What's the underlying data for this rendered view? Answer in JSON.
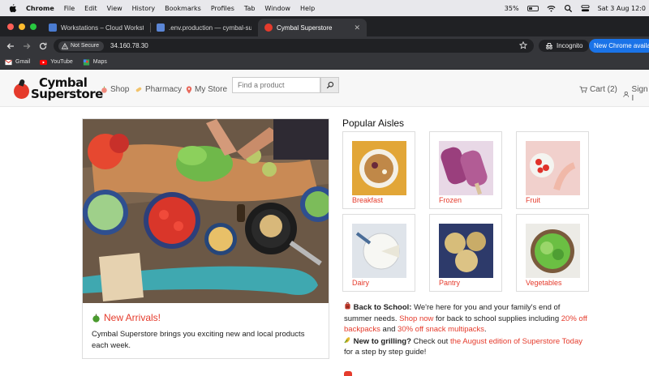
{
  "menubar": {
    "app": "Chrome",
    "items": [
      "File",
      "Edit",
      "View",
      "History",
      "Bookmarks",
      "Profiles",
      "Tab",
      "Window",
      "Help"
    ],
    "battery": "35%",
    "datetime": "Sat 3 Aug 12:0"
  },
  "tabs": [
    {
      "title": "Workstations – Cloud Workst",
      "active": false
    },
    {
      "title": ".env.production — cymbal-su",
      "active": false
    },
    {
      "title": "Cymbal Superstore",
      "active": true
    }
  ],
  "toolbar": {
    "security": "Not Secure",
    "url": "34.160.78.30",
    "incognito": "Incognito",
    "update": "New Chrome availa"
  },
  "bookmarks": [
    "Gmail",
    "YouTube",
    "Maps"
  ],
  "site": {
    "logo_line1": "Cymbal",
    "logo_line2": "Superstore",
    "nav": {
      "shop": "Shop",
      "pharmacy": "Pharmacy",
      "store": "My Store"
    },
    "search_placeholder": "Find a product",
    "cart": "Cart (2)",
    "signin": "Sign I"
  },
  "hero": {
    "title": "New Arrivals!",
    "description": "Cymbal Superstore brings you exciting new and local products each week."
  },
  "aisles": {
    "title": "Popular Aisles",
    "items": [
      "Breakfast",
      "Frozen",
      "Fruit",
      "Dairy",
      "Pantry",
      "Vegetables"
    ]
  },
  "info": {
    "school_bold": "Back to School:",
    "school_text1": " We're here for you and your family's end of summer needs. ",
    "school_link1": "Shop now",
    "school_text2": " for back to school supplies including ",
    "school_link2": "20% off backpacks",
    "school_text3": " and ",
    "school_link3": "30% off snack multipacks",
    "school_text4": ".",
    "grill_bold": "New to grilling?",
    "grill_text1": " Check out ",
    "grill_link": "the August edition of Superstore Today",
    "grill_text2": " for a step by step guide!"
  },
  "colors": {
    "brand_red": "#e53b2c",
    "chrome_dark": "#202124",
    "chrome_toolbar": "#35363a",
    "update_blue": "#1a73e8"
  }
}
